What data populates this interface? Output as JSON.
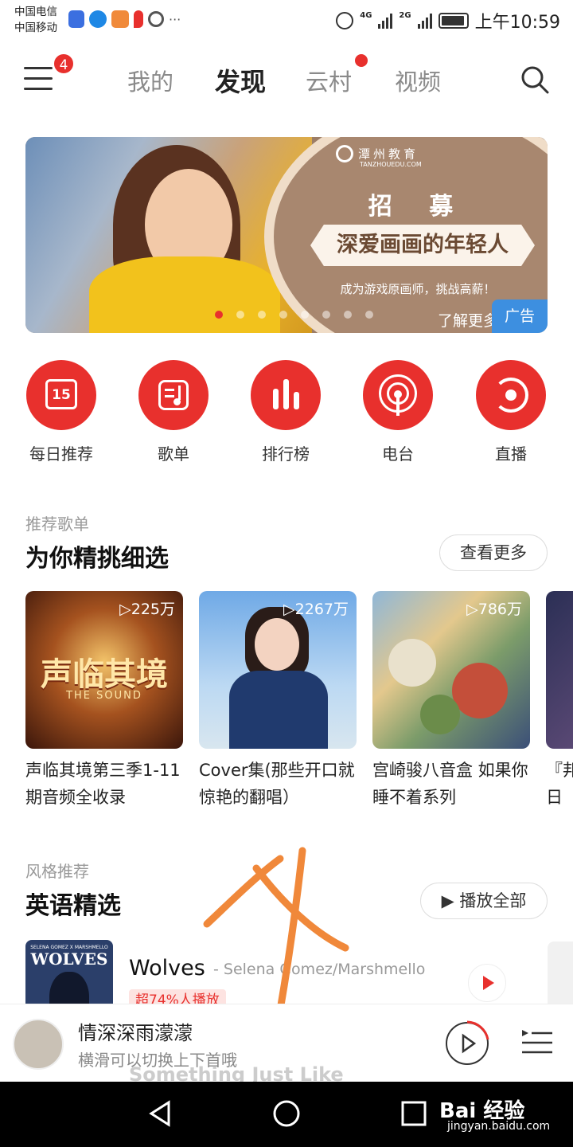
{
  "status_bar": {
    "carrier1": "中国电信",
    "carrier2": "中国移动",
    "net1": "4G",
    "net2": "2G",
    "time": "上午10:59",
    "more": "···"
  },
  "header": {
    "menu_badge": "4",
    "tabs": [
      {
        "label": "我的"
      },
      {
        "label": "发现"
      },
      {
        "label": "云村"
      },
      {
        "label": "视频"
      }
    ]
  },
  "banner": {
    "logo": "潭州教育",
    "logo_sub": "TANZHOUEDU.COM",
    "title": "招 募",
    "slogan": "深爱画画的年轻人",
    "subtitle": "成为游戏原画师，挑战高薪！",
    "more": "了解更多",
    "ad": "广告",
    "dots_total": 8,
    "dots_active": 1
  },
  "quick_entries": [
    {
      "label": "每日推荐",
      "icon": "calendar-15-icon",
      "day": "15"
    },
    {
      "label": "歌单",
      "icon": "playlist-icon"
    },
    {
      "label": "排行榜",
      "icon": "chart-bars-icon"
    },
    {
      "label": "电台",
      "icon": "radio-icon"
    },
    {
      "label": "直播",
      "icon": "live-icon"
    }
  ],
  "recommend": {
    "subtitle": "推荐歌单",
    "title": "为你精挑细选",
    "more": "查看更多",
    "cards": [
      {
        "count": "225万",
        "title": "声临其境第三季1-11期音频全收录",
        "cover_text": "声临其境",
        "cover_sub": "THE SOUND"
      },
      {
        "count": "2267万",
        "title": "Cover集(那些开口就惊艳的翻唱）"
      },
      {
        "count": "786万",
        "title": "宫崎骏八音盒 如果你睡不着系列"
      },
      {
        "count": "",
        "title": "『邦日文"
      }
    ]
  },
  "style": {
    "subtitle": "风格推荐",
    "title": "英语精选",
    "play_all": "播放全部",
    "song": {
      "title": "Wolves",
      "artist": "- Selena Gomez/Marshmello",
      "tag": "超74%人播放",
      "cover_text": "WOLVES",
      "cover_top": "SELENA GOMEZ X MARSHMELLO"
    }
  },
  "player": {
    "title": "情深深雨濛濛",
    "hint": "横滑可以切换上下首哦",
    "behind": "Something Just Like"
  },
  "watermark": {
    "text": "Bai 经验",
    "sub": "jingyan.baidu.com"
  },
  "colors": {
    "accent": "#e8302d",
    "ad_blue": "#3d8fe0",
    "annotation": "#f0883a"
  }
}
